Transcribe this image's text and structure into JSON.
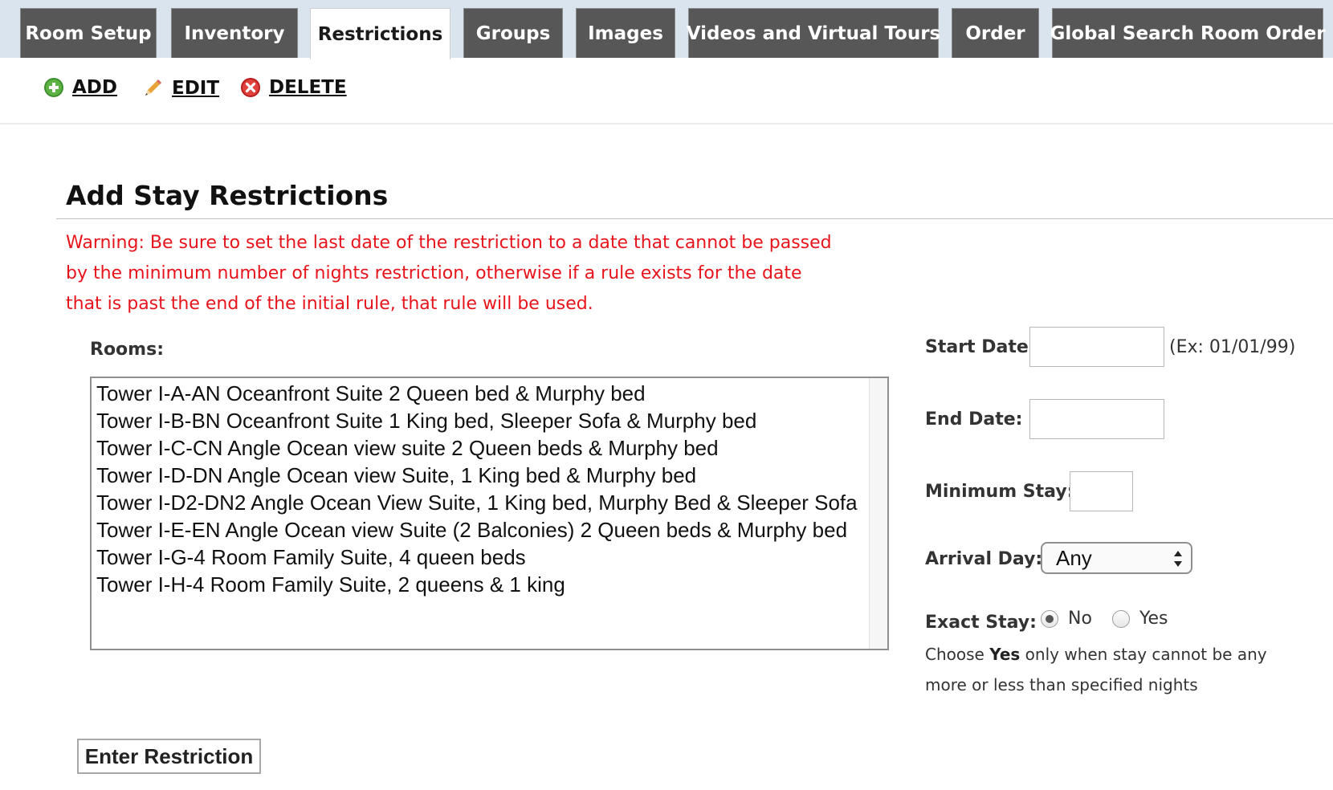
{
  "tabs": [
    {
      "label": "Room Setup",
      "active": false
    },
    {
      "label": "Inventory",
      "active": false
    },
    {
      "label": "Restrictions",
      "active": true
    },
    {
      "label": "Groups",
      "active": false
    },
    {
      "label": "Images",
      "active": false
    },
    {
      "label": "Videos and Virtual Tours",
      "active": false
    },
    {
      "label": "Order",
      "active": false
    },
    {
      "label": "Global Search Room Order",
      "active": false
    }
  ],
  "toolbar": {
    "add_label": "ADD",
    "edit_label": "EDIT",
    "delete_label": "DELETE"
  },
  "form": {
    "title": "Add Stay Restrictions",
    "warning": "Warning: Be sure to set the last date of the restriction to a date that cannot be passed by the minimum number of nights restriction, otherwise if a rule exists for the date that is past the end of the initial rule, that rule will be used.",
    "rooms_label": "Rooms:",
    "rooms": [
      "Tower I-A-AN Oceanfront Suite 2 Queen bed & Murphy bed",
      "Tower I-B-BN Oceanfront Suite 1 King bed, Sleeper Sofa & Murphy bed",
      "Tower I-C-CN Angle Ocean view suite 2 Queen beds & Murphy bed",
      "Tower I-D-DN Angle Ocean view Suite, 1 King bed & Murphy bed",
      "Tower I-D2-DN2 Angle Ocean View Suite, 1 King bed, Murphy Bed & Sleeper Sofa",
      "Tower I-E-EN Angle Ocean view Suite (2 Balconies) 2 Queen beds & Murphy bed",
      "Tower I-G-4 Room Family Suite, 4 queen beds",
      "Tower I-H-4 Room Family Suite, 2 queens & 1 king"
    ],
    "start_date_label": "Start Date:",
    "start_date_value": "",
    "start_date_hint": "(Ex: 01/01/99)",
    "end_date_label": "End Date:",
    "end_date_value": "",
    "min_stay_label": "Minimum Stay:",
    "min_stay_value": "",
    "arrival_day_label": "Arrival Day:",
    "arrival_day_value": "Any",
    "exact_stay_label": "Exact Stay:",
    "exact_stay_options": [
      "No",
      "Yes"
    ],
    "exact_stay_selected": "No",
    "exact_stay_note_prefix": "Choose ",
    "exact_stay_note_bold": "Yes",
    "exact_stay_note_suffix": " only when stay cannot be any more or less than specified nights",
    "submit_label": "Enter Restriction"
  },
  "colors": {
    "tab_bg": "#575757",
    "tab_bar_bg": "#d9e4ef",
    "warning_text": "#e8141b"
  }
}
